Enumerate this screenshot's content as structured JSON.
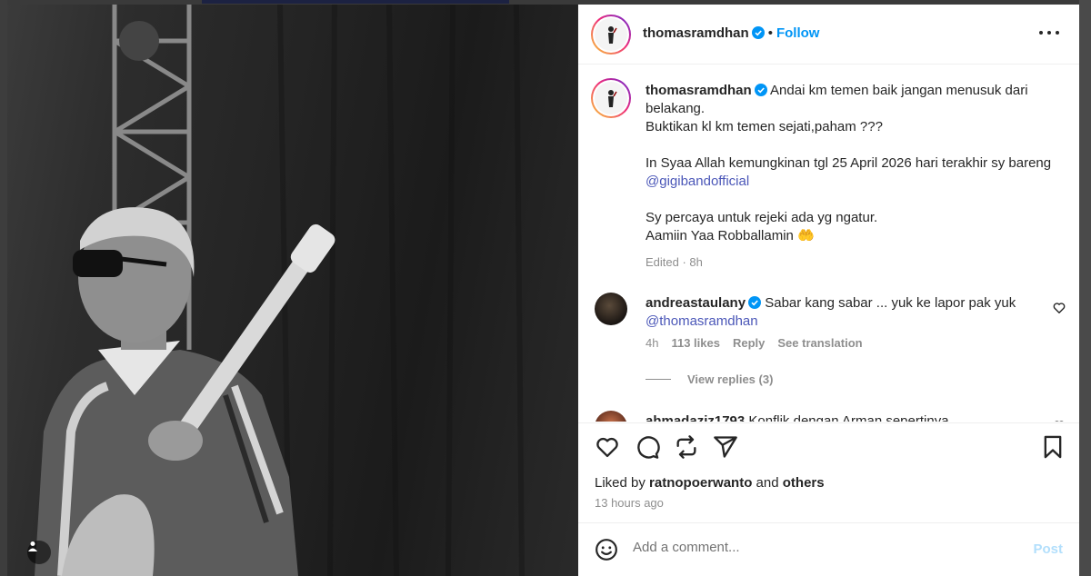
{
  "post": {
    "author": "thomasramdhan",
    "follow_label": "Follow",
    "separator": "•",
    "caption_lines": [
      "Andai km temen baik jangan menusuk dari belakang.",
      "Buktikan kl km temen sejati,paham ???",
      "",
      "In Syaa Allah kemungkinan tgl 25 April 2026 hari terakhir sy bareng "
    ],
    "caption_mention": "@gigibandofficial",
    "caption_tail": "Sy percaya untuk rejeki ada yg ngatur.\nAamiin Yaa Robballamin 🤲",
    "caption_meta": "Edited · 8h",
    "comments": [
      {
        "user": "andreastaulany",
        "text": "Sabar kang sabar ... yuk ke lapor pak yuk ",
        "mention": "@thomasramdhan",
        "age": "4h",
        "likes": "113 likes",
        "reply_label": "Reply",
        "translate_label": "See translation",
        "view_replies": "View replies (3)"
      },
      {
        "user": "ahmadaziz1793",
        "text": "Konflik dengan Arman sepertinya"
      }
    ],
    "liked_by_prefix": "Liked by ",
    "liked_by_user": "ratnopoerwanto",
    "liked_by_and": " and ",
    "liked_by_others": "others",
    "timestamp": "13 hours ago"
  },
  "composer": {
    "placeholder": "Add a comment...",
    "post_label": "Post"
  },
  "colors": {
    "accent": "#0095f6",
    "mention": "#4b57b8",
    "verified": "#0095f6"
  },
  "icons": [
    "heart-icon",
    "comment-icon",
    "repost-icon",
    "share-icon",
    "bookmark-icon",
    "emoji-icon",
    "more-icon",
    "verified-icon",
    "user-tag-icon"
  ]
}
